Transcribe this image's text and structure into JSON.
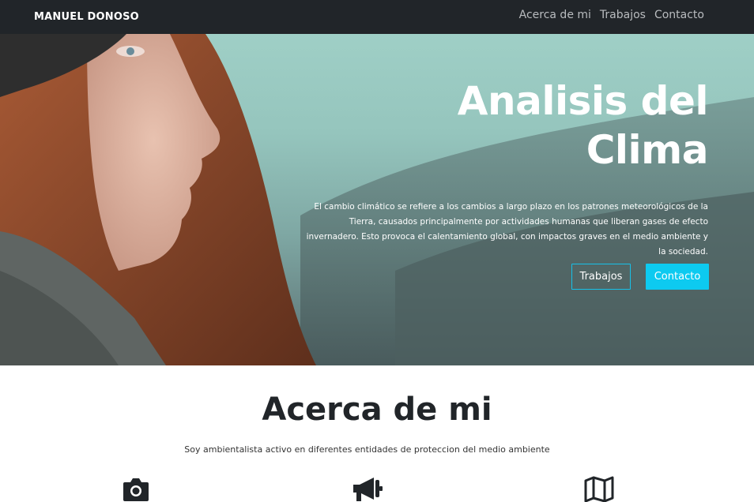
{
  "navbar": {
    "brand": "MANUEL DONOSO",
    "links": [
      "Acerca de mi",
      "Trabajos",
      "Contacto"
    ]
  },
  "hero": {
    "title_line1": "Analisis del",
    "title_line2": "Clima",
    "text": "El cambio climático se refiere a los cambios a largo plazo en los patrones meteorológicos de la Tierra, causados principalmente por actividades humanas que liberan gases de efecto invernadero. Esto provoca el calentamiento global, con impactos graves en el medio ambiente y la sociedad.",
    "buttons": {
      "works": "Trabajos",
      "contact": "Contacto"
    }
  },
  "about": {
    "title": "Acerca de mi",
    "text": "Soy ambientalista activo en diferentes entidades de proteccion del medio ambiente",
    "icons": [
      "camera-icon",
      "megaphone-icon",
      "map-icon"
    ]
  },
  "colors": {
    "navbar_bg": "#212529",
    "accent": "#0dcaf0"
  }
}
